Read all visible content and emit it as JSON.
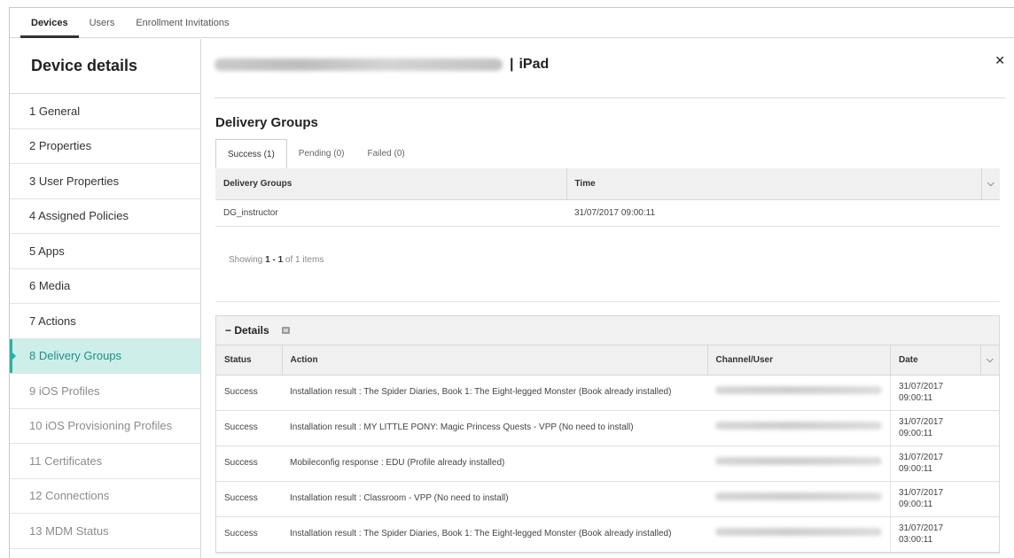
{
  "topnav": {
    "tabs": [
      "Devices",
      "Users",
      "Enrollment Invitations"
    ],
    "active_index": 0
  },
  "sidebar": {
    "title": "Device details",
    "items": [
      {
        "label": "1 General",
        "state": "normal"
      },
      {
        "label": "2 Properties",
        "state": "normal"
      },
      {
        "label": "3 User Properties",
        "state": "normal"
      },
      {
        "label": "4 Assigned Policies",
        "state": "normal"
      },
      {
        "label": "5 Apps",
        "state": "normal"
      },
      {
        "label": "6 Media",
        "state": "normal"
      },
      {
        "label": "7 Actions",
        "state": "normal"
      },
      {
        "label": "8 Delivery Groups",
        "state": "active"
      },
      {
        "label": "9 iOS Profiles",
        "state": "disabled"
      },
      {
        "label": "10 iOS Provisioning Profiles",
        "state": "disabled"
      },
      {
        "label": "11 Certificates",
        "state": "disabled"
      },
      {
        "label": "12 Connections",
        "state": "disabled"
      },
      {
        "label": "13 MDM Status",
        "state": "disabled"
      }
    ]
  },
  "header": {
    "separator": "|",
    "device": "iPad",
    "close_icon": "close-icon"
  },
  "delivery": {
    "title": "Delivery Groups",
    "tabs": [
      "Success (1)",
      "Pending (0)",
      "Failed (0)"
    ],
    "active_tab": 0,
    "columns": [
      "Delivery Groups",
      "Time"
    ],
    "rows": [
      {
        "group": "DG_instructor",
        "time": "31/07/2017 09:00:11"
      }
    ],
    "showing_prefix": "Showing ",
    "showing_range": "1 - 1",
    "showing_suffix": " of 1 items"
  },
  "details": {
    "title": "− Details",
    "columns": [
      "Status",
      "Action",
      "Channel/User",
      "Date"
    ],
    "rows": [
      {
        "status": "Success",
        "action": "Installation result : The Spider Diaries, Book 1: The Eight-legged Monster (Book already installed)",
        "date_line1": "31/07/2017",
        "date_line2": "09:00:11"
      },
      {
        "status": "Success",
        "action": "Installation result : MY LITTLE PONY: Magic Princess Quests - VPP (No need to install)",
        "date_line1": "31/07/2017",
        "date_line2": "09:00:11"
      },
      {
        "status": "Success",
        "action": "Mobileconfig response : EDU (Profile already installed)",
        "date_line1": "31/07/2017",
        "date_line2": "09:00:11"
      },
      {
        "status": "Success",
        "action": "Installation result : Classroom - VPP (No need to install)",
        "date_line1": "31/07/2017",
        "date_line2": "09:00:11"
      },
      {
        "status": "Success",
        "action": "Installation result : The Spider Diaries, Book 1: The Eight-legged Monster (Book already installed)",
        "date_line1": "31/07/2017",
        "date_line2": "03:00:11"
      }
    ]
  },
  "colors": {
    "accent": "#2bb0a5",
    "active_bg": "#cdeee9"
  }
}
